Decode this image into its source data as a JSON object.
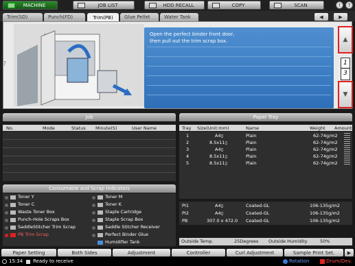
{
  "topbar": {
    "machine": "MACHINE",
    "job_list": "JOB LIST",
    "hdd_recall": "HDD RECALL",
    "copy": "COPY",
    "scan": "SCAN",
    "info_icon": "!",
    "help_icon": "?"
  },
  "tabs": [
    {
      "label": "Trim(SD)"
    },
    {
      "label": "Punch(FD)"
    },
    {
      "label": "Trim(PB)"
    },
    {
      "label": "Glue Pellet"
    },
    {
      "label": "Water Tank"
    }
  ],
  "tab_prev": "◀",
  "tab_next": "▶",
  "guide": {
    "line1": "Open the perfect binder front door,",
    "line2": "then pull out the trim scrap box.",
    "help_mark": "?",
    "page_current": "1",
    "page_total": "3"
  },
  "job": {
    "title": "Job",
    "columns": [
      "No.",
      "Mode",
      "Status",
      "Minute(S)",
      "User Name"
    ]
  },
  "consumables": {
    "title": "Consumable and Scrap Indicators",
    "left": [
      {
        "label": "Toner Y",
        "alert": false
      },
      {
        "label": "Toner C",
        "alert": false
      },
      {
        "label": "Waste Toner Box",
        "alert": false
      },
      {
        "label": "Punch-Hole Scraps Box",
        "alert": false
      },
      {
        "label": "SaddleStitcher Trim Scrap",
        "alert": false
      },
      {
        "label": "PB Trim Scrap",
        "alert": true
      }
    ],
    "right": [
      {
        "label": "Toner M",
        "alert": false
      },
      {
        "label": "Toner K",
        "alert": false
      },
      {
        "label": "Staple Cartridge",
        "alert": false
      },
      {
        "label": "Staple Scrap Box",
        "alert": false
      },
      {
        "label": "Saddle Stitcher Receiver",
        "alert": false
      },
      {
        "label": "Perfect Binder Glue",
        "alert": false
      },
      {
        "label": "Humidifier Tank",
        "alert": false
      }
    ]
  },
  "paper_tray": {
    "title": "Paper Tray",
    "columns": [
      "Tray",
      "Size(Unit:mm)",
      "Name",
      "Weight",
      "Amount"
    ],
    "rows": [
      {
        "tray": "1",
        "size": "A4▯",
        "name": "Plain",
        "weight": "62-74g/m2"
      },
      {
        "tray": "2",
        "size": "8.5x11▯",
        "name": "Plain",
        "weight": "62-74g/m2"
      },
      {
        "tray": "3",
        "size": "A4▯",
        "name": "Plain",
        "weight": "62-74g/m2"
      },
      {
        "tray": "4",
        "size": "8.5x11▯",
        "name": "Plain",
        "weight": "62-74g/m2"
      },
      {
        "tray": "5",
        "size": "8.5x11▯",
        "name": "Plain",
        "weight": "62-74g/m2"
      }
    ],
    "post_rows": [
      {
        "tray": "PI1",
        "size": "A4▯",
        "name": "Coated-GL",
        "weight": "106-135g/m2"
      },
      {
        "tray": "PI2",
        "size": "A4▯",
        "name": "Coated-GL",
        "weight": "106-135g/m2"
      },
      {
        "tray": "PB",
        "size": "307.0 x 472.0",
        "name": "Coated-GL",
        "weight": "106-135g/m2"
      }
    ],
    "outside_temp_label": "Outside Temp.",
    "outside_temp_value": "25Degrees",
    "outside_humidity_label": "Outside Humidity",
    "outside_humidity_value": "50%"
  },
  "bottom": {
    "paper_setting": "Paper Setting",
    "both_sides": "Both Sides",
    "adjustment": "Adjustment",
    "controller": "Controller",
    "curl_adjustment": "Curl Adjustment",
    "sample_print": "Sample Print Set.",
    "next": "▶"
  },
  "status": {
    "time": "15:34",
    "message": "Ready to receive",
    "rotation": "Rotation",
    "drum": "Drum/Dev."
  }
}
